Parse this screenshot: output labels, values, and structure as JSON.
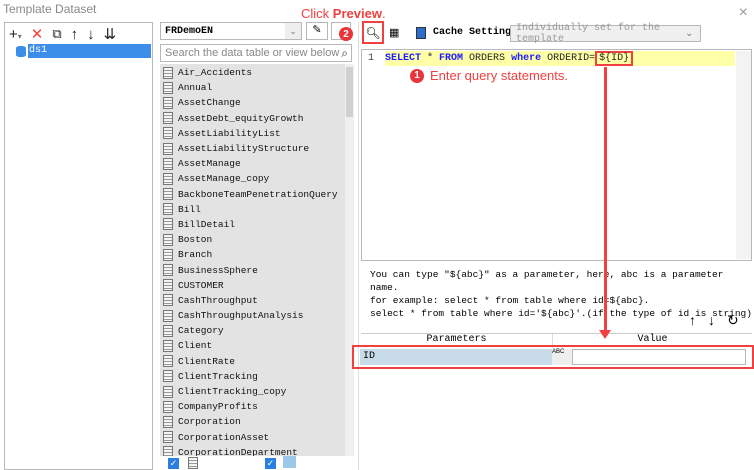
{
  "window": {
    "title": "Template Dataset",
    "close": "×"
  },
  "left": {
    "toolbar": {
      "add": "+",
      "add_caret": "▾",
      "delete": "✕",
      "copy": "⧉",
      "up": "↑",
      "down": "↓",
      "sort": "⇊"
    },
    "datasets": [
      {
        "name": "ds1"
      }
    ]
  },
  "middle": {
    "connection": "FRDemoEN",
    "search_placeholder": "Search the data table or view below",
    "tables": [
      "Air_Accidents",
      "Annual",
      "AssetChange",
      "AssetDebt_equityGrowth",
      "AssetLiabilityList",
      "AssetLiabilityStructure",
      "AssetManage",
      "AssetManage_copy",
      "BackboneTeamPenetrationQuery",
      "Bill",
      "BillDetail",
      "Boston",
      "Branch",
      "BusinessSphere",
      "CUSTOMER",
      "CashThroughput",
      "CashThroughputAnalysis",
      "Category",
      "Client",
      "ClientRate",
      "ClientTracking",
      "ClientTracking_copy",
      "CompanyProfits",
      "Corporation",
      "CorporationAsset",
      "CorporationDepartment"
    ]
  },
  "right": {
    "cache_label": "Cache Settings",
    "cache_value": "Individually set for the template",
    "sql": {
      "line_no": "1",
      "kw1": "SELECT",
      "star": " * ",
      "kw2": "FROM",
      "t1": " ORDERS ",
      "kw3": "where",
      "t2": " ORDERID=",
      "param": "${ID}"
    },
    "help": [
      "You can type \"${abc}\" as a parameter, here, abc is a parameter name.",
      "for example: select * from table where id=${abc}.",
      "select * from table where id='${abc}'.(if the type of id is string)"
    ],
    "params_table": {
      "headers": [
        "Parameters",
        "Value"
      ],
      "rows": [
        {
          "name": "ID",
          "type": "ABC",
          "value": ""
        }
      ]
    }
  },
  "annotations": {
    "step1_num": "1",
    "step1": "Enter query statements.",
    "step2_num": "2",
    "step2_prefix": "Click ",
    "step2_bold": "Preview",
    "step2_suffix": "."
  },
  "colors": {
    "accent": "#f04040",
    "selection": "#3d8ee8",
    "sql_keyword": "#1a1aff"
  }
}
